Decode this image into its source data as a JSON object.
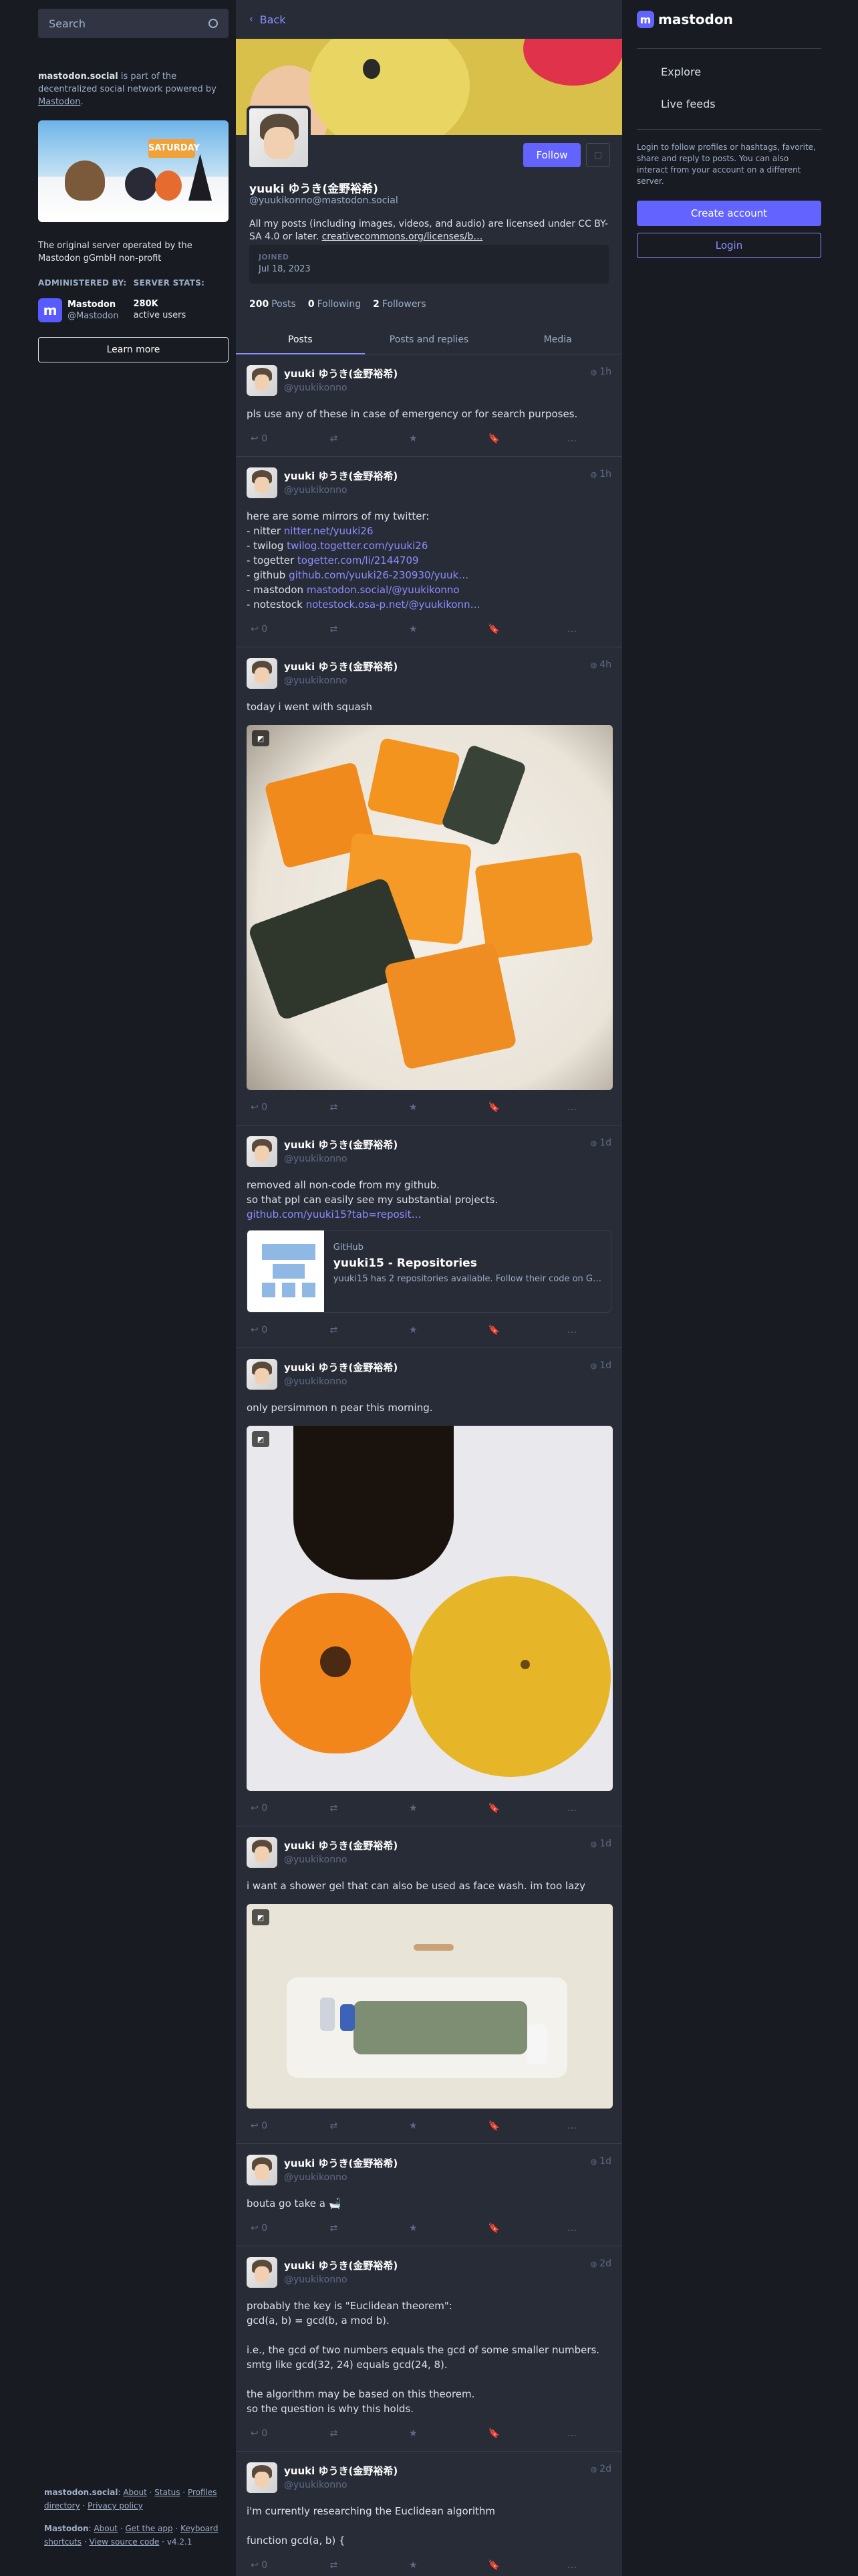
{
  "search": {
    "placeholder": "Search"
  },
  "about": {
    "server": "mastodon.social",
    "text": " is part of the decentralized social network powered by ",
    "link": "Mastodon",
    "end": "."
  },
  "hero_flag": "SATURDAY",
  "server_description": "The original server operated by the Mastodon gGmbH non-profit",
  "administered_by": {
    "heading": "ADMINISTERED BY:",
    "name": "Mastodon",
    "handle": "@Mastodon"
  },
  "server_stats": {
    "heading": "SERVER STATS:",
    "value": "280K",
    "label": "active users"
  },
  "learn_more": "Learn more",
  "footer": {
    "server": "mastodon.social",
    "links1": [
      "About",
      "Status",
      "Profiles directory",
      "Privacy policy"
    ],
    "app": "Mastodon",
    "links2": [
      "About",
      "Get the app",
      "Keyboard shortcuts",
      "View source code"
    ],
    "version": "v4.2.1"
  },
  "back": "Back",
  "profile": {
    "display_name": "yuuki ゆうき(金野裕希)",
    "handle": "@yuukikonno@mastodon.social",
    "follow": "Follow",
    "bio": "All my posts (including images, videos, and audio) are licensed under CC BY-SA 4.0 or later. ",
    "bio_link": "creativecommons.org/licenses/b…",
    "joined_label": "JOINED",
    "joined_date": "Jul 18, 2023",
    "posts_count": "200",
    "posts_label": "Posts",
    "following_count": "0",
    "following_label": "Following",
    "followers_count": "2",
    "followers_label": "Followers"
  },
  "tabs": [
    "Posts",
    "Posts and replies",
    "Media"
  ],
  "post_author": {
    "name": "yuuki ゆうき(金野裕希)",
    "handle": "@yuukikonno"
  },
  "posts": [
    {
      "time": "1h",
      "text": "pls use any of these in case of emergency or for search purposes.",
      "replies": "0"
    },
    {
      "time": "1h",
      "lines": [
        {
          "t": "here are some mirrors of my twitter:"
        },
        {
          "t": "- nitter ",
          "l": "nitter.net/yuuki26"
        },
        {
          "t": "- twilog ",
          "l": "twilog.togetter.com/yuuki26"
        },
        {
          "t": "- togetter ",
          "l": "togetter.com/li/2144709"
        },
        {
          "t": "- github ",
          "l": "github.com/yuuki26-230930/yuuk…"
        },
        {
          "t": " "
        },
        {
          "t": "- mastodon ",
          "l": "mastodon.social/@yuukikonno"
        },
        {
          "t": "- notestock ",
          "l": "notestock.osa-p.net/@yuukikonn…"
        }
      ],
      "replies": "0"
    },
    {
      "time": "4h",
      "text": "today i went with squash",
      "replies": "0"
    },
    {
      "time": "1d",
      "text": "removed all non-code from my github.\nso that ppl can easily see my substantial projects.",
      "link": "github.com/yuuki15?tab=reposit…",
      "card": {
        "site": "GitHub",
        "title": "yuuki15 - Repositories",
        "desc": "yuuki15 has 2 repositories available. Follow their code on G…"
      },
      "replies": "0"
    },
    {
      "time": "1d",
      "text": "only persimmon n pear this morning.",
      "replies": "0"
    },
    {
      "time": "1d",
      "text": "i want a shower gel that can also be used as face wash. im too lazy",
      "replies": "0"
    },
    {
      "time": "1d",
      "text": "bouta go take a 🛁",
      "replies": "0"
    },
    {
      "time": "2d",
      "text": "probably the key is \"Euclidean theorem\":\ngcd(a, b) = gcd(b, a mod b).\n\ni.e., the gcd of two numbers equals the gcd of some smaller numbers.\nsmtg like gcd(32, 24) equals gcd(24, 8).\n\nthe algorithm may be based on this theorem.\nso the question is why this holds.",
      "replies": "0"
    },
    {
      "time": "2d",
      "text": "i'm currently researching the Euclidean algorithm\n\nfunction gcd(a, b) {",
      "replies": "0"
    }
  ],
  "brand": "mastodon",
  "right_nav": [
    "Explore",
    "Live feeds"
  ],
  "login_hint": "Login to follow profiles or hashtags, favorite, share and reply to posts. You can also interact from your account on a different server.",
  "create_account": "Create account",
  "login": "Login",
  "colors": {
    "accent": "#6364ff",
    "link": "#8c8dff",
    "bg": "#191b22",
    "panel": "#282c37"
  }
}
